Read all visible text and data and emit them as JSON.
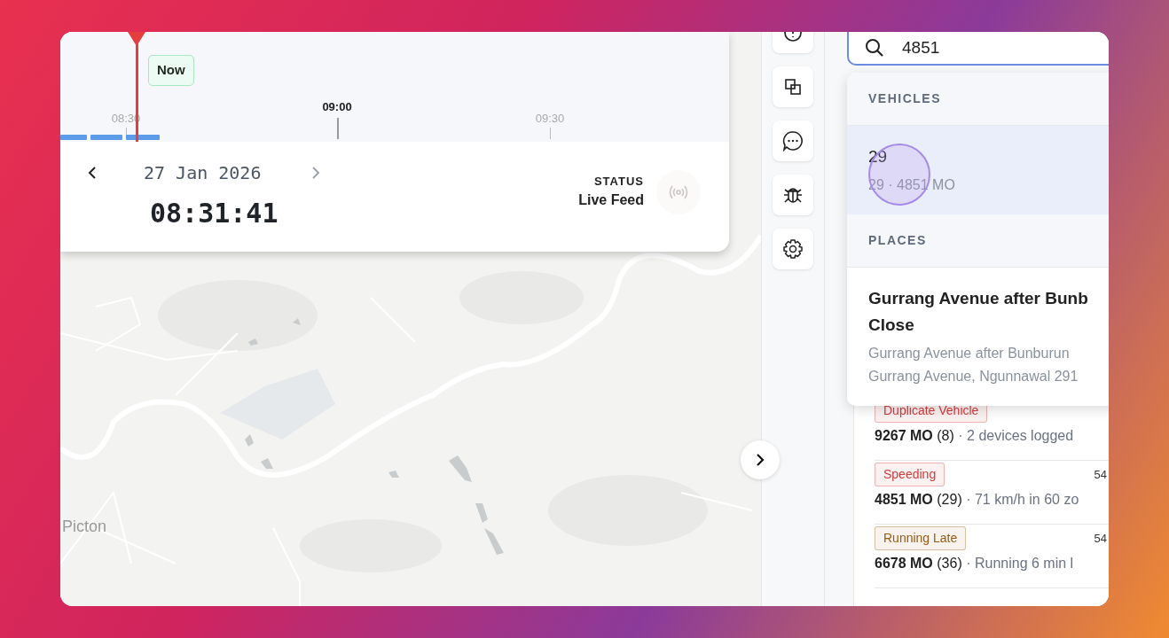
{
  "timeline": {
    "now_label": "Now",
    "ticks": [
      {
        "label": "08:30",
        "major": false
      },
      {
        "label": "09:00",
        "major": true
      },
      {
        "label": "09:30",
        "major": false
      }
    ]
  },
  "date_nav": {
    "date": "27 Jan 2026",
    "time": "08:31:41"
  },
  "status": {
    "label": "STATUS",
    "value": "Live Feed"
  },
  "map": {
    "place_label": "Picton"
  },
  "search": {
    "value": "4851"
  },
  "results": [
    {
      "heading": "VEHICLES",
      "items": [
        {
          "title_lines": [
            "29"
          ],
          "subtitle_lines": [
            "29 · 4851 MO"
          ],
          "selected": true
        }
      ]
    },
    {
      "heading": "PLACES",
      "items": [
        {
          "title_lines": [
            "Gurrang Avenue after Bunb",
            "Close"
          ],
          "subtitle_lines": [
            "Gurrang Avenue after Bunburun",
            "Gurrang Avenue, Ngunnawal 291"
          ],
          "selected": false
        }
      ]
    }
  ],
  "alerts": [
    {
      "tag": "Duplicate Vehicle",
      "color": "#d33b3b",
      "vehicle": "9267 MO",
      "route": "(8)",
      "detail": "· 2 devices logged"
    },
    {
      "tag": "Speeding",
      "color": "#d33b3b",
      "vehicle": "4851 MO",
      "route": "(29)",
      "detail": "· 71 km/h in 60 zo",
      "time": "54"
    },
    {
      "tag": "Running Late",
      "color": "#9a5a10",
      "vehicle": "6678 MO",
      "route": "(36)",
      "detail": "· Running 6 min l",
      "time": "54"
    }
  ]
}
